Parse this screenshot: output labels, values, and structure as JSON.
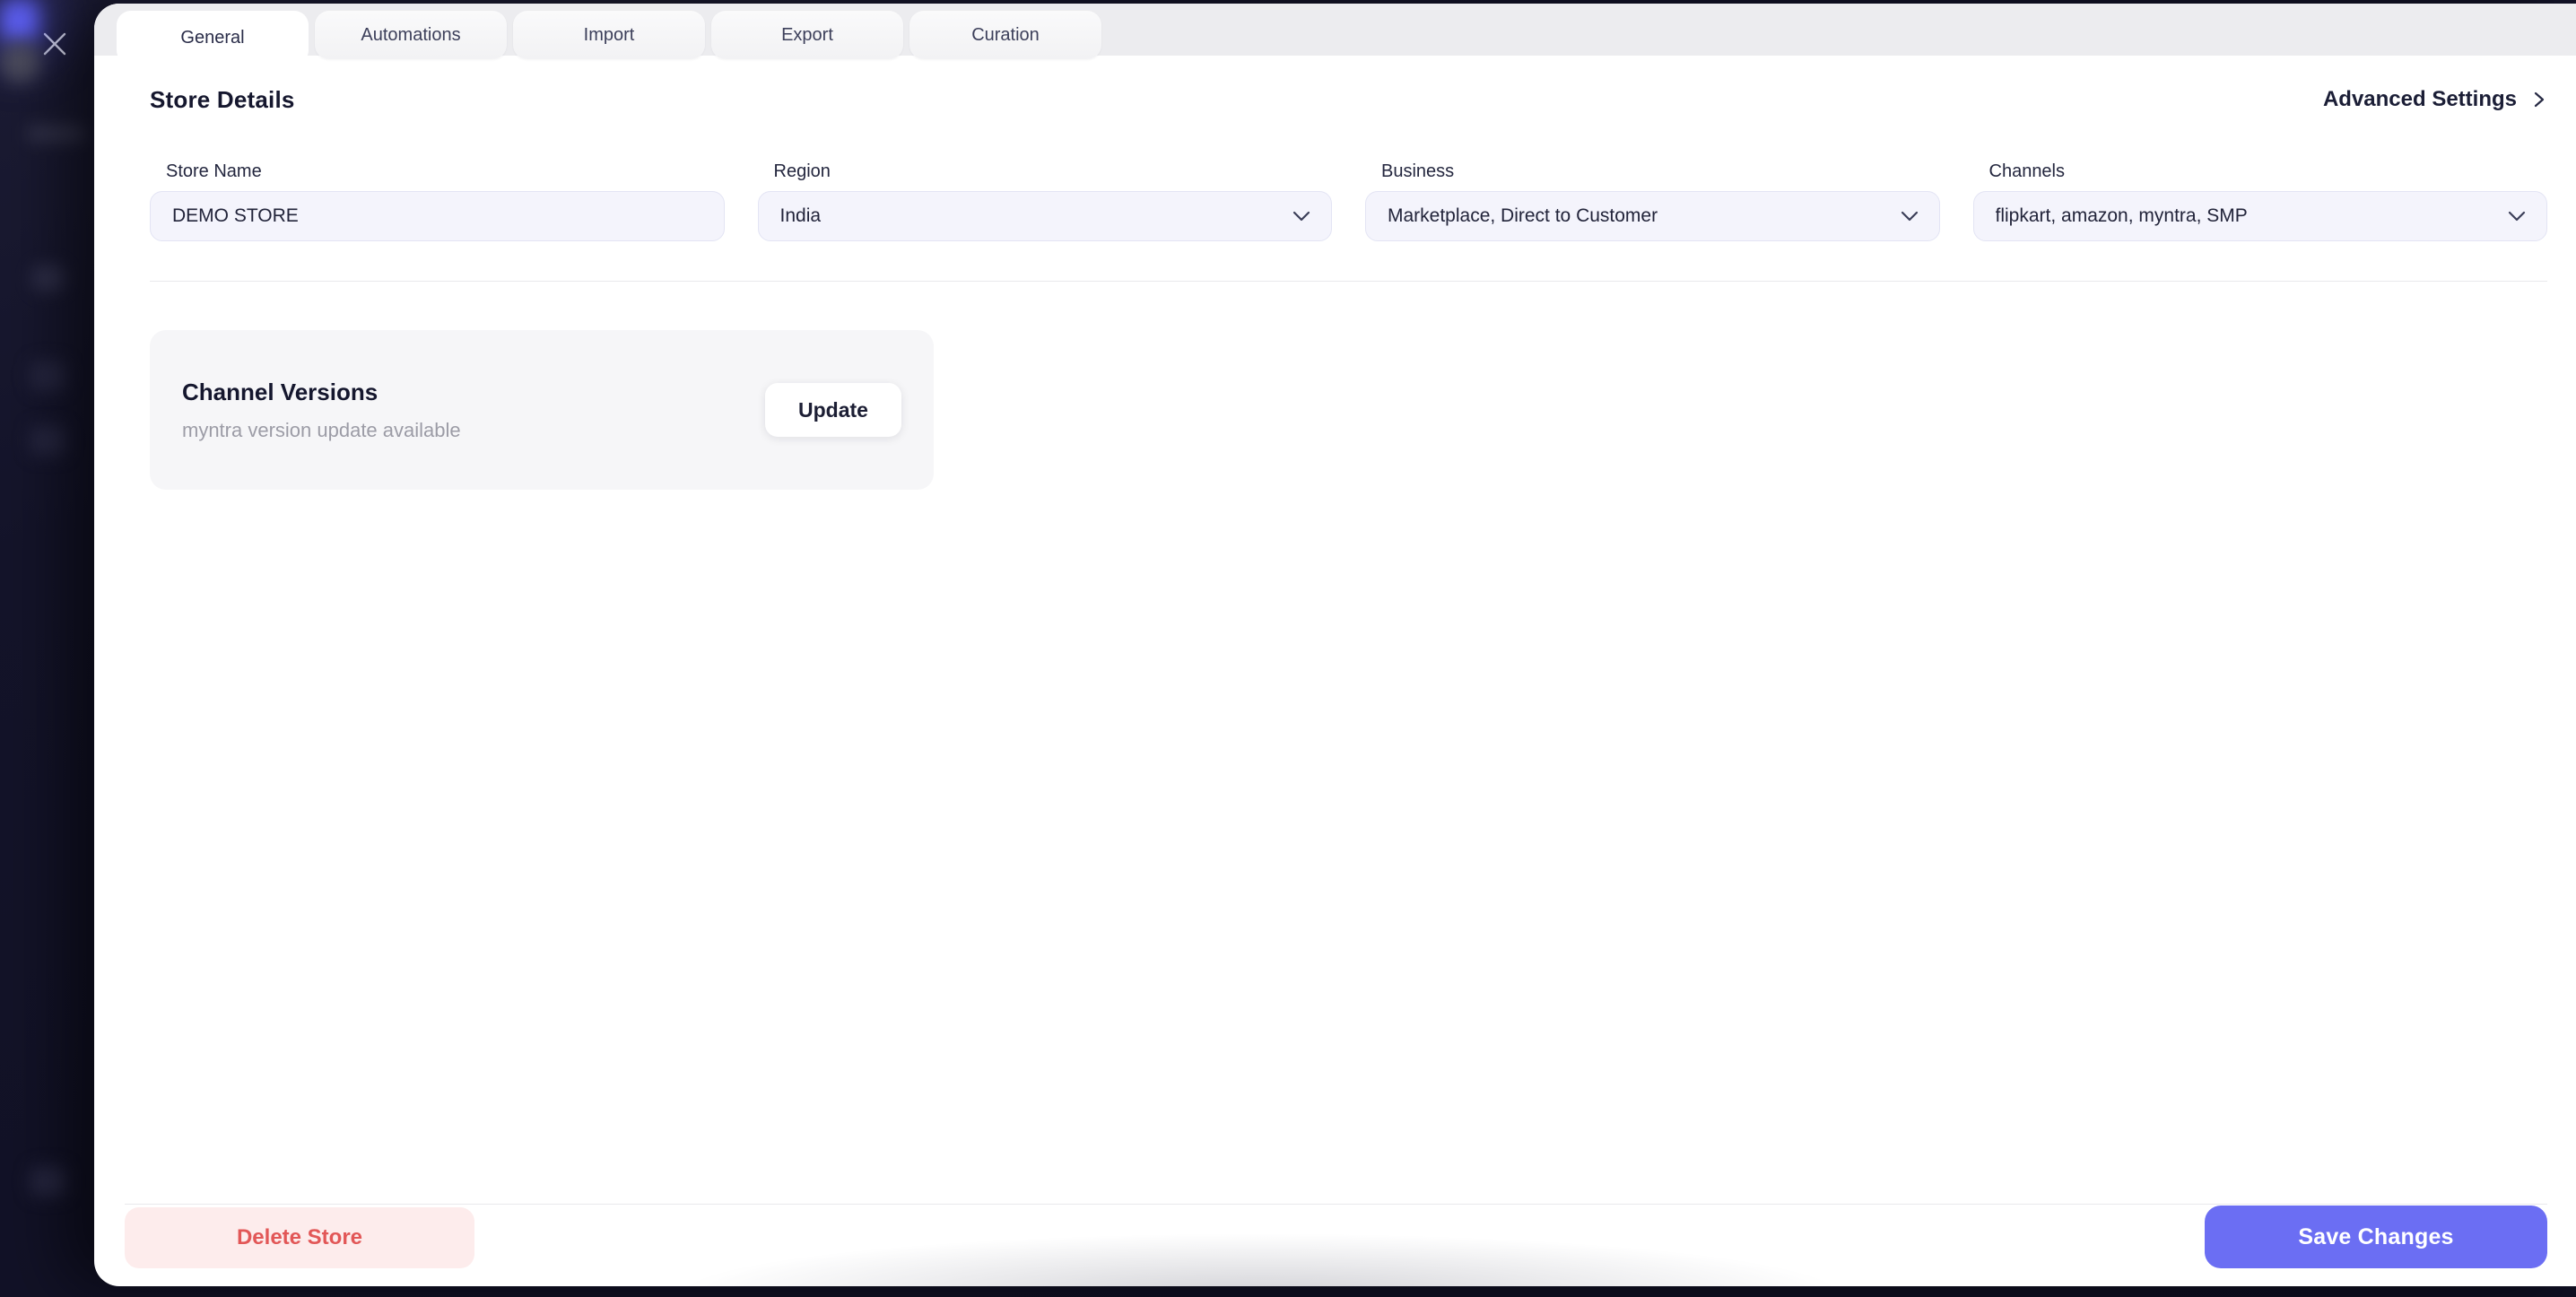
{
  "colors": {
    "accent": "#6b6ef3",
    "danger_text": "#e25757",
    "danger_bg": "#fdecec",
    "sidebar_bg": "#14142a",
    "tabbar_bg": "#ececef",
    "input_bg": "#f4f4fc",
    "card_bg": "#f6f6f8",
    "subtitle_gray": "#9c9ca6",
    "active_nav_glow": "#5c5ef0"
  },
  "icons": {
    "close": "close-icon",
    "chevron_down": "chevron-down-icon",
    "chevron_right": "›"
  },
  "modal": {
    "tabs": [
      {
        "label": "General",
        "active": true
      },
      {
        "label": "Automations",
        "active": false
      },
      {
        "label": "Import",
        "active": false
      },
      {
        "label": "Export",
        "active": false
      },
      {
        "label": "Curation",
        "active": false
      }
    ],
    "header": {
      "title": "Store Details",
      "advanced_settings_label": "Advanced Settings",
      "chevron": "›"
    },
    "form": {
      "fields": [
        {
          "label": "Store Name",
          "value": "DEMO STORE",
          "type": "input"
        },
        {
          "label": "Region",
          "value": "India",
          "type": "select"
        },
        {
          "label": "Business",
          "value": "Marketplace, Direct to Customer",
          "type": "select"
        },
        {
          "label": "Channels",
          "value": "flipkart, amazon, myntra, SMP",
          "type": "select"
        }
      ]
    },
    "channel_versions": {
      "title": "Channel Versions",
      "subtitle": "myntra version update available",
      "update_label": "Update"
    },
    "footer": {
      "delete_label": "Delete Store",
      "save_label": "Save Changes"
    }
  }
}
